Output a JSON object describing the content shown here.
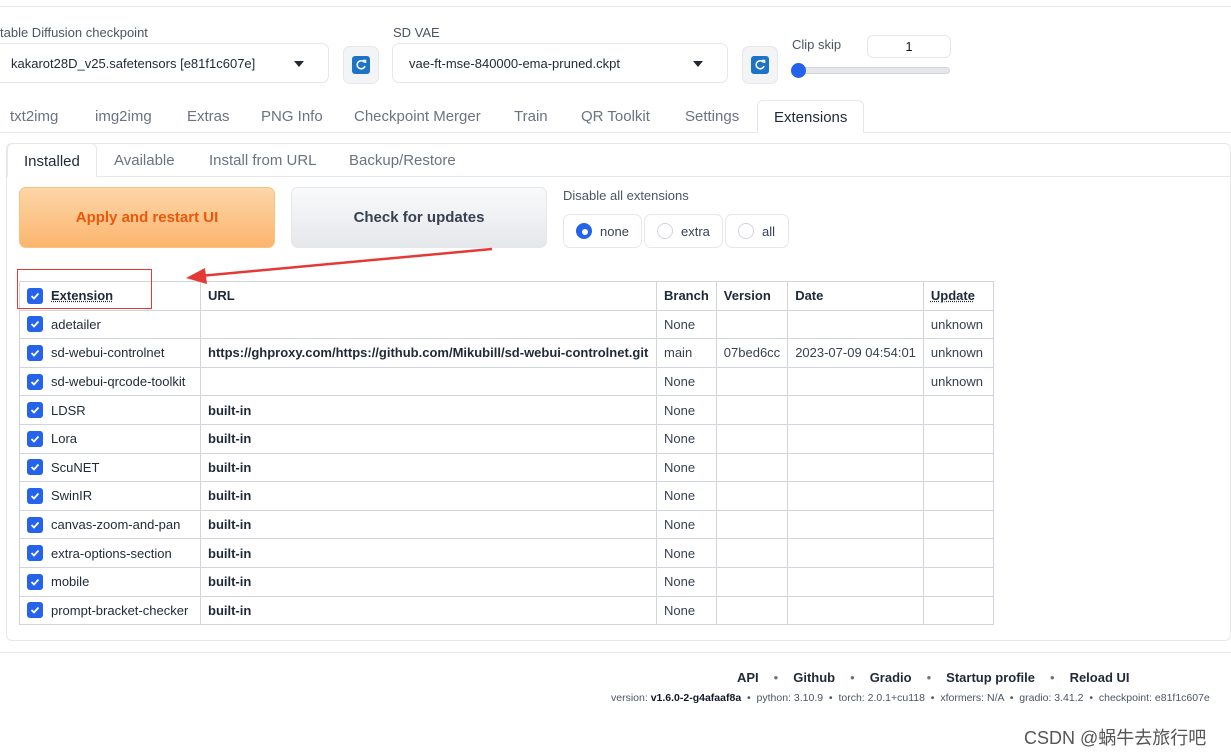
{
  "settings": {
    "checkpoint_label": "table Diffusion checkpoint",
    "checkpoint_value": "kakarot28D_v25.safetensors [e81f1c607e]",
    "vae_label": "SD VAE",
    "vae_value": "vae-ft-mse-840000-ema-pruned.ckpt",
    "clip_skip_label": "Clip skip",
    "clip_skip_value": "1"
  },
  "tabs": [
    "txt2img",
    "img2img",
    "Extras",
    "PNG Info",
    "Checkpoint Merger",
    "Train",
    "QR Toolkit",
    "Settings",
    "Extensions"
  ],
  "subtabs": [
    "Installed",
    "Available",
    "Install from URL",
    "Backup/Restore"
  ],
  "buttons": {
    "apply": "Apply and restart UI",
    "check": "Check for updates"
  },
  "disable": {
    "label": "Disable all extensions",
    "options": [
      "none",
      "extra",
      "all"
    ],
    "selected": "none"
  },
  "table": {
    "headers": [
      "Extension",
      "URL",
      "Branch",
      "Version",
      "Date",
      "Update"
    ],
    "rows": [
      {
        "name": "adetailer",
        "url": "",
        "branch": "None",
        "version": "",
        "date": "",
        "update": "unknown"
      },
      {
        "name": "sd-webui-controlnet",
        "url": "https://ghproxy.com/https://github.com/Mikubill/sd-webui-controlnet.git",
        "branch": "main",
        "version": "07bed6cc",
        "date": "2023-07-09 04:54:01",
        "update": "unknown"
      },
      {
        "name": "sd-webui-qrcode-toolkit",
        "url": "",
        "branch": "None",
        "version": "",
        "date": "",
        "update": "unknown"
      },
      {
        "name": "LDSR",
        "url": "built-in",
        "branch": "None",
        "version": "",
        "date": "",
        "update": ""
      },
      {
        "name": "Lora",
        "url": "built-in",
        "branch": "None",
        "version": "",
        "date": "",
        "update": ""
      },
      {
        "name": "ScuNET",
        "url": "built-in",
        "branch": "None",
        "version": "",
        "date": "",
        "update": ""
      },
      {
        "name": "SwinIR",
        "url": "built-in",
        "branch": "None",
        "version": "",
        "date": "",
        "update": ""
      },
      {
        "name": "canvas-zoom-and-pan",
        "url": "built-in",
        "branch": "None",
        "version": "",
        "date": "",
        "update": ""
      },
      {
        "name": "extra-options-section",
        "url": "built-in",
        "branch": "None",
        "version": "",
        "date": "",
        "update": ""
      },
      {
        "name": "mobile",
        "url": "built-in",
        "branch": "None",
        "version": "",
        "date": "",
        "update": ""
      },
      {
        "name": "prompt-bracket-checker",
        "url": "built-in",
        "branch": "None",
        "version": "",
        "date": "",
        "update": ""
      }
    ]
  },
  "footer": {
    "links": [
      "API",
      "Github",
      "Gradio",
      "Startup profile",
      "Reload UI"
    ],
    "version_label": "version:",
    "version_value": "v1.6.0-2-g4afaaf8a",
    "python": "python: 3.10.9",
    "torch": "torch: 2.0.1+cu118",
    "xformers": "xformers: N/A",
    "gradio": "gradio: 3.41.2",
    "checkpoint": "checkpoint: e81f1c607e"
  },
  "watermark": "CSDN @蜗牛去旅行吧",
  "colors": {
    "accent": "#2563eb",
    "annotation": "#e53935",
    "apply_text": "#ea580c"
  }
}
